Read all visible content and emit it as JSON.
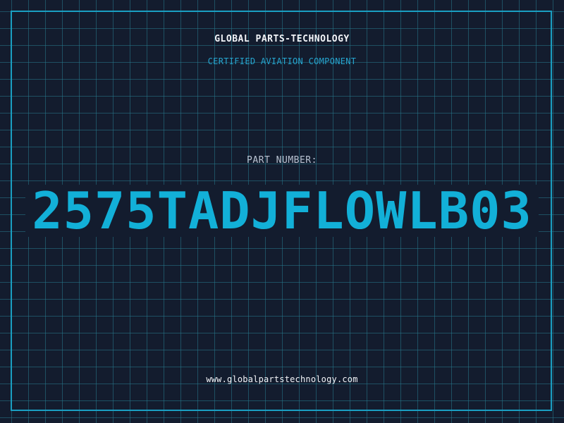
{
  "header": {
    "company": "GLOBAL PARTS-TECHNOLOGY",
    "subtitle": "CERTIFIED AVIATION COMPONENT"
  },
  "part": {
    "label": "PART NUMBER:",
    "number": "2575TADJFLOWLB03"
  },
  "footer": {
    "url": "www.globalpartstechnology.com"
  },
  "colors": {
    "background": "#131c2e",
    "grid": "#26788c",
    "frame": "#1a9fc2",
    "accent": "#12b0d8",
    "text": "#f2f4f8"
  }
}
